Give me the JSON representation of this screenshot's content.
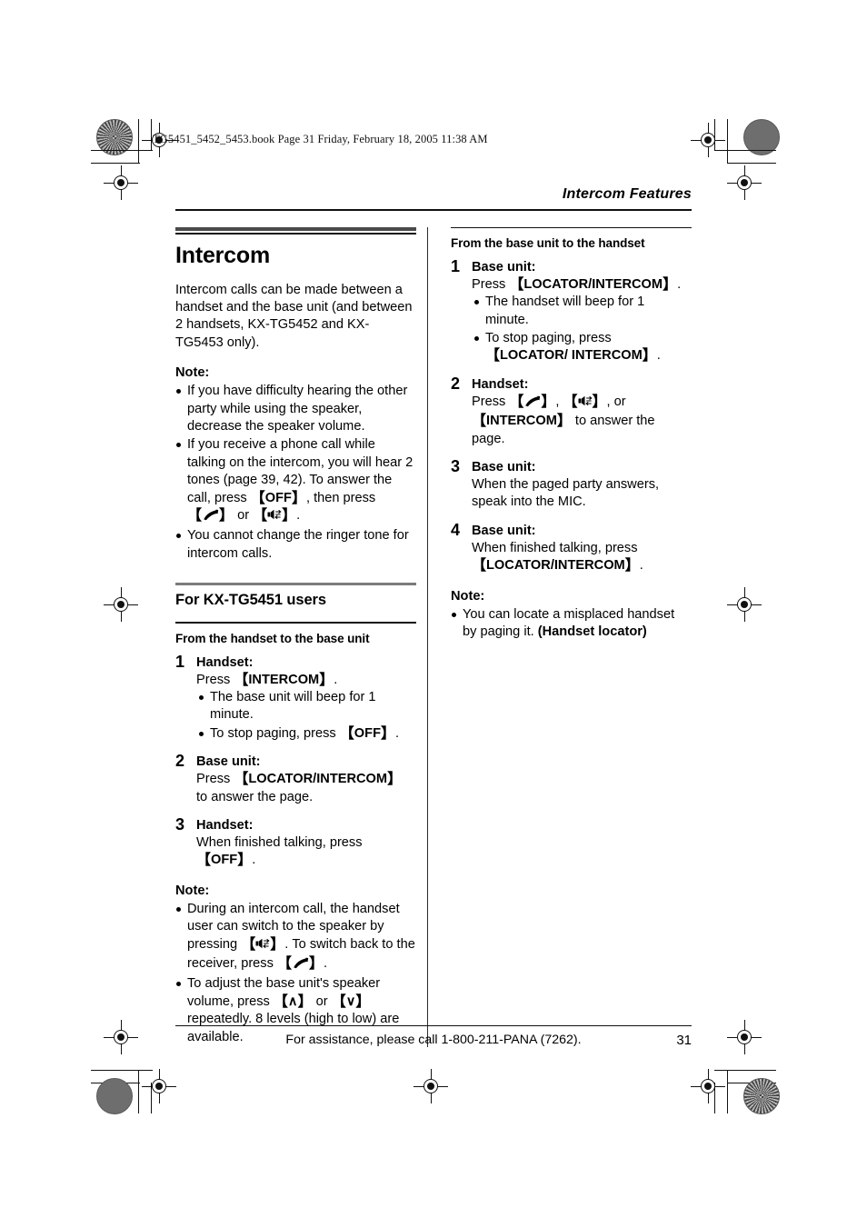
{
  "document": {
    "book_line": "TG5451_5452_5453.book  Page 31  Friday, February 18, 2005  11:38 AM",
    "running_head": "Intercom Features",
    "page_number": "31",
    "footer_text": "For assistance, please call 1-800-211-PANA (7262)."
  },
  "left_column": {
    "chapter_title": "Intercom",
    "intro": "Intercom calls can be made between a handset and the base unit (and between 2 handsets, KX-TG5452 and KX-TG5453 only).",
    "note_label": "Note:",
    "notes": [
      "If you have difficulty hearing the other party while using the speaker, decrease the speaker volume.",
      "If you receive a phone call while talking on the intercom, you will hear 2 tones (page 39, 42). To answer the call, press ",
      "You cannot change the ringer tone for intercom calls."
    ],
    "note2_parts": {
      "lead": "If you receive a phone call while talking on the intercom, you will hear 2 tones (page 39, 42). To answer the call, press ",
      "key_off": "OFF",
      "mid": ", then press ",
      "or": " or ",
      "tail": "."
    },
    "section_title": "For KX-TG5451 users",
    "sub_title": "From the handset to the base unit",
    "steps": [
      {
        "num": "1",
        "role": "Handset:",
        "text_lead": "Press ",
        "key": "INTERCOM",
        "text_tail": ".",
        "bullets": [
          {
            "lead": "The base unit will beep for 1 minute.",
            "key": "",
            "tail": ""
          },
          {
            "lead": "To stop paging, press ",
            "key": "OFF",
            "tail": "."
          }
        ]
      },
      {
        "num": "2",
        "role": "Base unit:",
        "text_lead": "Press ",
        "key": "LOCATOR/INTERCOM",
        "text_tail": " to answer the page.",
        "bullets": []
      },
      {
        "num": "3",
        "role": "Handset:",
        "text_lead": "When finished talking, press ",
        "key": "OFF",
        "text_tail": ".",
        "bullets": []
      }
    ],
    "note2_label": "Note:",
    "bottom_notes": {
      "n1_lead": "During an intercom call, the handset user can switch to the speaker by pressing ",
      "n1_mid": ". To switch back to the receiver, press ",
      "n1_tail": ".",
      "n2_lead": "To adjust the base unit's speaker volume, press ",
      "n2_up": "∧",
      "n2_or": " or ",
      "n2_down": "∨",
      "n2_tail": " repeatedly. 8 levels (high to low) are available."
    }
  },
  "right_column": {
    "sub_title": "From the base unit to the handset",
    "steps": [
      {
        "num": "1",
        "role": "Base unit:",
        "text_lead": "Press ",
        "key": "LOCATOR/INTERCOM",
        "text_tail": ".",
        "bullets": [
          {
            "lead": "The handset will beep for 1 minute.",
            "key": "",
            "tail": ""
          },
          {
            "lead": "To stop paging, press ",
            "key": "LOCATOR/ INTERCOM",
            "tail": "."
          }
        ]
      },
      {
        "num": "2",
        "role": "Handset:",
        "text_lead": "Press ",
        "key": "INTERCOM",
        "text_tail": " to answer the page.",
        "bullets": []
      },
      {
        "num": "3",
        "role": "Base unit:",
        "text_lead": "When the paged party answers, speak into the MIC.",
        "key": "",
        "text_tail": "",
        "bullets": []
      },
      {
        "num": "4",
        "role": "Base unit:",
        "text_lead": "When finished talking, press ",
        "key": "LOCATOR/INTERCOM",
        "text_tail": ".",
        "bullets": []
      }
    ],
    "note_label": "Note:",
    "note_lead": "You can locate a misplaced handset by paging it. ",
    "note_bold": "(Handset locator)"
  },
  "icons": {
    "talk": "talk-handset-icon",
    "speakerphone": "speakerphone-icon",
    "volume_up": "volume-up-icon",
    "volume_down": "volume-down-icon"
  }
}
